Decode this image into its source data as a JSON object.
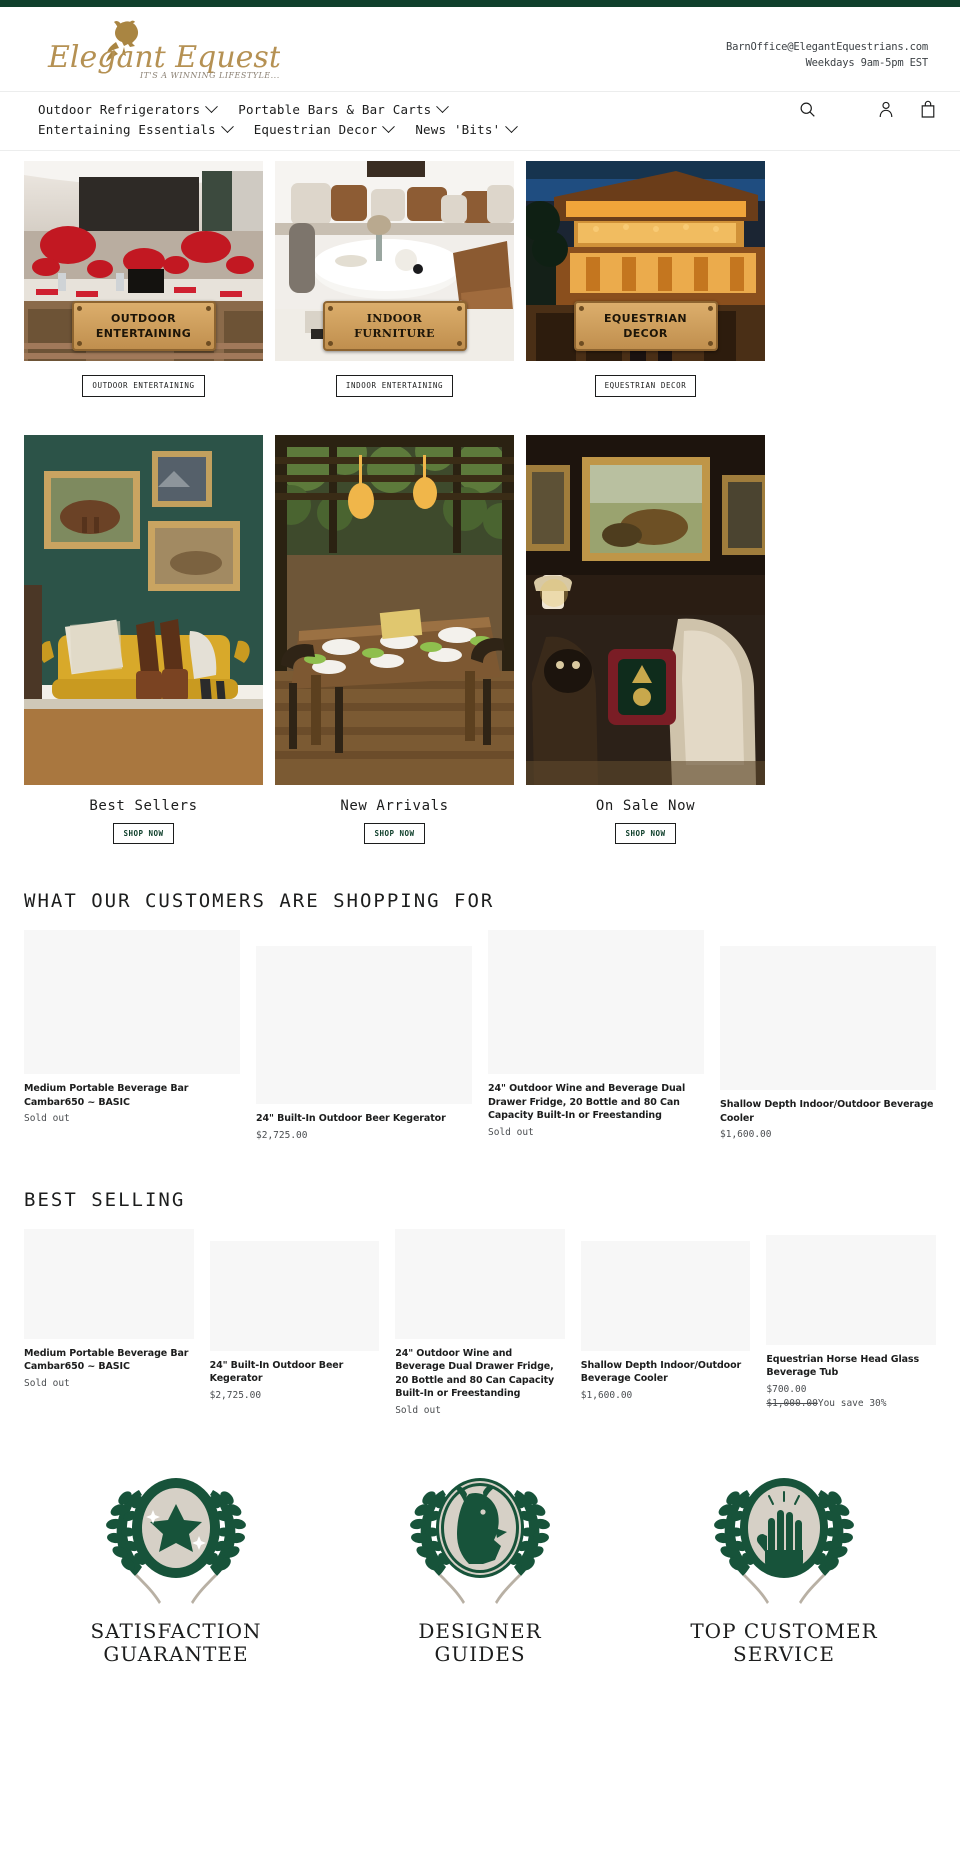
{
  "brand": {
    "name": "Elegant Equestrians",
    "tagline": "IT'S A WINNING LIFESTYLE...",
    "accent_green": "#10402c",
    "accent_gold": "#b08d4f"
  },
  "header": {
    "email": "BarnOffice@ElegantEquestrians.com",
    "hours": "Weekdays 9am-5pm EST"
  },
  "nav": {
    "items": [
      {
        "label": "Outdoor Refrigerators",
        "has_dropdown": true
      },
      {
        "label": "Portable Bars & Bar Carts",
        "has_dropdown": true
      },
      {
        "label": "Entertaining Essentials",
        "has_dropdown": true
      },
      {
        "label": "Equestrian Decor",
        "has_dropdown": true
      },
      {
        "label": "News 'Bits'",
        "has_dropdown": true
      }
    ],
    "icons": [
      {
        "name": "search-icon",
        "label": "Search"
      },
      {
        "name": "account-icon",
        "label": "Log in"
      },
      {
        "name": "cart-icon",
        "label": "Cart"
      }
    ]
  },
  "banners": [
    {
      "plaque_line1": "OUTDOOR",
      "plaque_line2": "ENTERTAINING",
      "button_label": "OUTDOOR ENTERTAINING",
      "style": "sans"
    },
    {
      "plaque_line1": "INDOOR",
      "plaque_line2": "FURNITURE",
      "button_label": "INDOOR ENTERTAINING",
      "style": "serif"
    },
    {
      "plaque_line1": "EQUESTRIAN",
      "plaque_line2": "DECOR",
      "button_label": "EQUESTRIAN DECOR",
      "style": "sans"
    }
  ],
  "collections": [
    {
      "title": "Best Sellers",
      "button_label": "SHOP NOW"
    },
    {
      "title": "New Arrivals",
      "button_label": "SHOP NOW"
    },
    {
      "title": "On Sale Now",
      "button_label": "SHOP NOW"
    }
  ],
  "shopping_for": {
    "heading": "WHAT OUR CUSTOMERS ARE SHOPPING FOR",
    "products": [
      {
        "title": "Medium Portable Beverage Bar Cambar650 ~ BASIC",
        "price": "Sold out",
        "compare_at": "",
        "savings": ""
      },
      {
        "title": "24\" Built-In Outdoor Beer Kegerator",
        "price": "$2,725.00",
        "compare_at": "",
        "savings": ""
      },
      {
        "title": "24\" Outdoor Wine and Beverage Dual Drawer Fridge, 20 Bottle and 80 Can Capacity Built-In or Freestanding",
        "price": "Sold out",
        "compare_at": "",
        "savings": ""
      },
      {
        "title": "Shallow Depth Indoor/Outdoor Beverage Cooler",
        "price": "$1,600.00",
        "compare_at": "",
        "savings": ""
      }
    ]
  },
  "best_selling": {
    "heading": "BEST SELLING",
    "products": [
      {
        "title": "Medium Portable Beverage Bar Cambar650 ~ BASIC",
        "price": "Sold out",
        "compare_at": "",
        "savings": ""
      },
      {
        "title": "24\" Built-In Outdoor Beer Kegerator",
        "price": "$2,725.00",
        "compare_at": "",
        "savings": ""
      },
      {
        "title": "24\" Outdoor Wine and Beverage Dual Drawer Fridge, 20 Bottle and 80 Can Capacity Built-In or Freestanding",
        "price": "Sold out",
        "compare_at": "",
        "savings": ""
      },
      {
        "title": "Shallow Depth Indoor/Outdoor Beverage Cooler",
        "price": "$1,600.00",
        "compare_at": "",
        "savings": ""
      },
      {
        "title": "Equestrian Horse Head Glass Beverage Tub",
        "price": "$700.00",
        "compare_at": "$1,000.00",
        "savings": "You save 30%"
      }
    ]
  },
  "badges": [
    {
      "icon": "laurel-star-seal-icon",
      "line1": "SATISFACTION",
      "line2": "GUARANTEE"
    },
    {
      "icon": "laurel-horse-seal-icon",
      "line1": "DESIGNER",
      "line2": "GUIDES"
    },
    {
      "icon": "laurel-hand-seal-icon",
      "line1": "TOP CUSTOMER",
      "line2": "SERVICE"
    }
  ]
}
